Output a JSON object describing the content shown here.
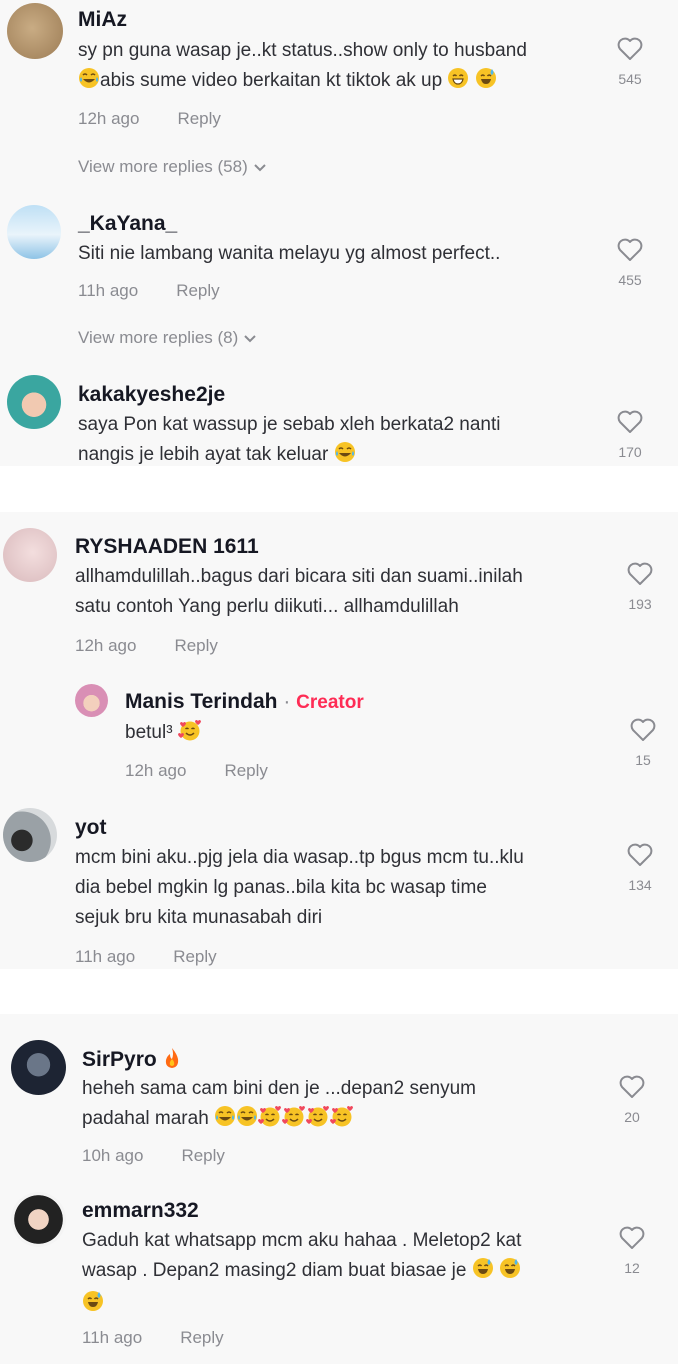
{
  "reply_label": "Reply",
  "colors": {
    "panel": "#f8f8f8",
    "text": "#161823",
    "muted": "#8a8b91",
    "creator": "#fe2c55",
    "emoji": "#f7c325"
  },
  "icons": {
    "like": "heart-outline-icon",
    "chevron": "chevron-down-icon",
    "emoji_laugh": "face-with-tears-of-joy",
    "emoji_grin": "beaming-face",
    "emoji_sweat": "grinning-face-with-sweat",
    "emoji_hearts": "smiling-face-with-hearts",
    "flame": "fire-icon"
  },
  "comments": [
    {
      "username": "MiAz",
      "text": "sy pn guna wasap je..kt status..show only to husband",
      "text2": "abis sume video berkaitan kt tiktok ak up",
      "time": "12h ago",
      "likes": "545",
      "view_more": "View more replies (58)"
    },
    {
      "username": "_KaYana_",
      "text": "Siti nie lambang wanita melayu yg almost perfect..",
      "time": "11h ago",
      "likes": "455",
      "view_more": "View more replies (8)"
    },
    {
      "username": "kakakyeshe2je",
      "text": "saya Pon kat wassup je sebab xleh berkata2 nanti",
      "text2": "nangis je lebih ayat tak keluar",
      "likes": "170"
    },
    {
      "username": "RYSHAADEN 1611",
      "text": "allhamdulillah..bagus dari bicara siti dan suami..inilah\nsatu contoh Yang perlu diikuti... allhamdulillah",
      "time": "12h ago",
      "likes": "193"
    },
    {
      "username": "Manis Terindah",
      "badge": "Creator",
      "separator": "·",
      "text": "betul³",
      "time": "12h ago",
      "likes": "15"
    },
    {
      "username": "yot",
      "text": "mcm bini aku..pjg jela dia wasap..tp bgus mcm tu..klu\ndia bebel mgkin lg panas..bila kita bc wasap time\nsejuk bru kita munasabah diri",
      "time": "11h ago",
      "likes": "134"
    },
    {
      "username": "SirPyro",
      "text": "heheh sama cam bini den je ...depan2 senyum",
      "text2": "padahal marah",
      "time": "10h ago",
      "likes": "20"
    },
    {
      "username": "emmarn332",
      "text": "Gaduh kat whatsapp mcm aku hahaa . Meletop2 kat",
      "text2": "wasap . Depan2 masing2 diam buat biasae je",
      "time": "11h ago",
      "likes": "12"
    }
  ]
}
